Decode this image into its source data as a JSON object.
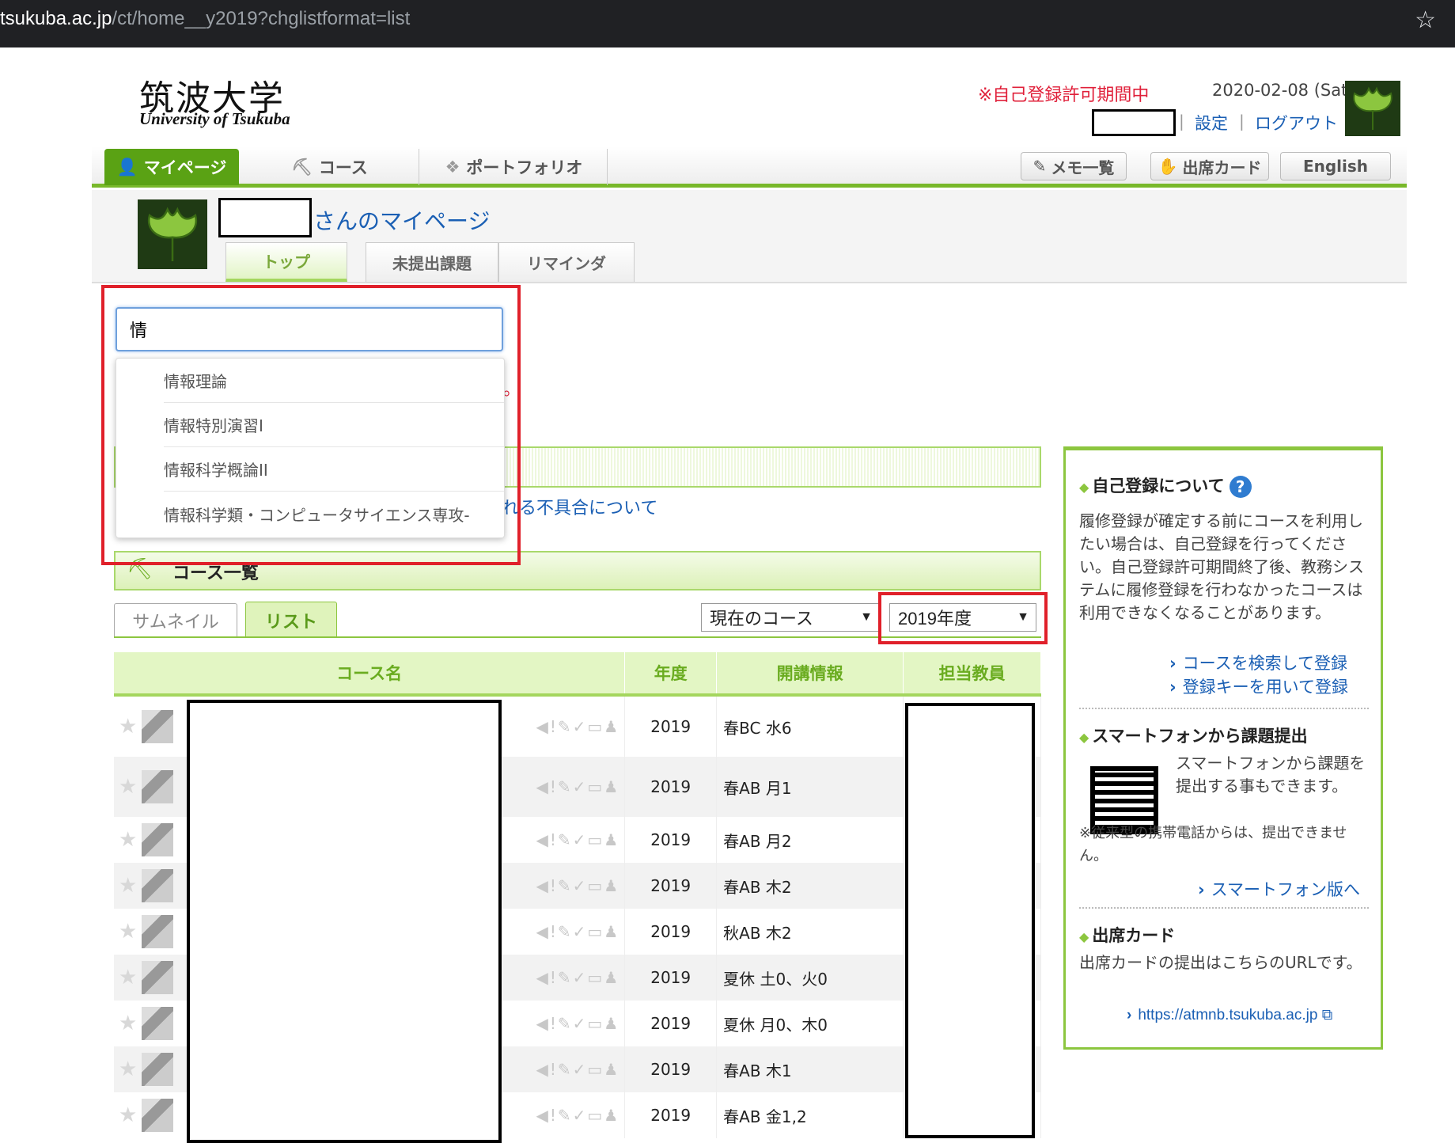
{
  "browser": {
    "url_host": "tsukuba.ac.jp",
    "url_path": "/ct/home__y2019?chglistformat=list"
  },
  "header": {
    "logo_jp": "筑波大学",
    "logo_en": "University of Tsukuba",
    "notice": "※自己登録許可期間中",
    "date": "2020-02-08 (Sat)",
    "settings": "設定",
    "logout": "ログアウト"
  },
  "nav": {
    "mypage": "マイページ",
    "course": "コース",
    "portfolio": "ポートフォリオ",
    "memo": "メモ一覧",
    "attendance": "出席カード",
    "english": "English"
  },
  "mypage": {
    "title_suffix": "さんのマイページ",
    "tabs": [
      "トップ",
      "未提出課題",
      "リマインダ"
    ]
  },
  "search": {
    "value": "情",
    "suggestions": [
      "情報理論",
      "情報特別演習I",
      "情報科学概論II",
      "情報科学類・コンピュータサイエンス専攻-"
    ]
  },
  "obscured": {
    "dot_text": "。",
    "link_text": "れる不具合について"
  },
  "courses": {
    "band_label": "コース一覧",
    "view_thumb": "サムネイル",
    "view_list": "リスト",
    "scope_select": "現在のコース",
    "year_select": "2019年度",
    "columns": [
      "コース名",
      "年度",
      "開講情報",
      "担当教員"
    ],
    "rows": [
      {
        "year": "2019",
        "term": "春BC 水6"
      },
      {
        "year": "2019",
        "term": "春AB 月1"
      },
      {
        "year": "2019",
        "term": "春AB 月2"
      },
      {
        "year": "2019",
        "term": "春AB 木2"
      },
      {
        "year": "2019",
        "term": "秋AB 木2"
      },
      {
        "year": "2019",
        "term": "夏休 土0、火0"
      },
      {
        "year": "2019",
        "term": "夏休 月0、木0"
      },
      {
        "year": "2019",
        "term": "春AB 木1"
      },
      {
        "year": "2019",
        "term": "春AB 金1,2"
      }
    ]
  },
  "sidebar": {
    "self_reg_title": "自己登録について",
    "self_reg_text": "履修登録が確定する前にコースを利用したい場合は、自己登録を行ってください。自己登録許可期間終了後、教務システムに履修登録を行わなかったコースは利用できなくなることがあります。",
    "link_search": "コースを検索して登録",
    "link_key": "登録キーを用いて登録",
    "smartphone_title": "スマートフォンから課題提出",
    "smartphone_text": "スマートフォンから課題を提出する事もできます。",
    "smartphone_note": "※従来型の携帯電話からは、提出できません。",
    "smartphone_link": "スマートフォン版へ",
    "attendance_title": "出席カード",
    "attendance_text": "出席カードの提出はこちらのURLです。",
    "attendance_link": "https://atmnb.tsukuba.ac.jp"
  },
  "colors": {
    "accent_green": "#78b82a",
    "link_blue": "#1a5fb4",
    "alert_red": "#e0203a"
  }
}
